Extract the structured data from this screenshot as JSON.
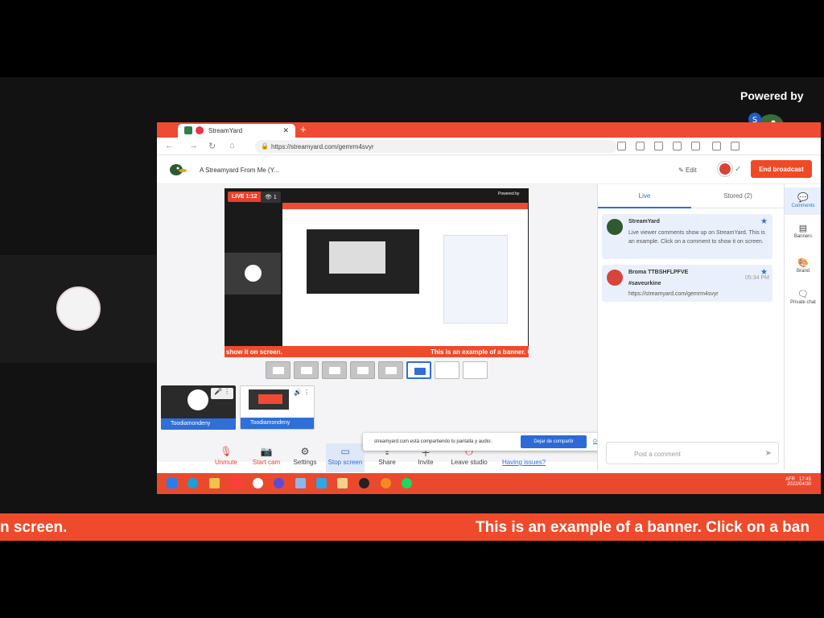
{
  "overlay": {
    "powered_by": "Powered by",
    "banner_left": "n screen.",
    "banner_right": "This is an example of a banner. Click on a ban"
  },
  "browser": {
    "tab_title": "StreamYard",
    "new_tab": "+",
    "url": "https://streamyard.com/gemrm4svyr"
  },
  "studio": {
    "broadcast_title": "A Streamyard From Me (Y...",
    "edit_label": "Edit",
    "end_broadcast_label": "End broadcast",
    "preview": {
      "live_badge": "LIVE 1:12",
      "viewer_count": "1",
      "powered": "Powered by",
      "banner_left": "show it on screen.",
      "banner_right": "This is an example of a banner. Clic"
    },
    "participants": [
      {
        "name": "Toodiamondeny"
      },
      {
        "name": "Toodiamondeny"
      }
    ],
    "toolbar": {
      "unmute": "Unmute",
      "start_cam": "Start cam",
      "settings": "Settings",
      "stop_screen": "Stop screen",
      "share": "Share",
      "invite": "Invite",
      "leave": "Leave studio",
      "issues": "Having issues?"
    },
    "share_notice": {
      "text": "streamyard.com está compartiendo tu pantalla y audio.",
      "stop_btn": "Dejar de compartir",
      "hide_btn": "Ocultar"
    }
  },
  "chat": {
    "tab_live": "Live",
    "tab_stored": "Stored (2)",
    "comments": [
      {
        "author": "StreamYard",
        "body": "Live viewer comments show up on StreamYard. This is an example. Click on a comment to show it on screen."
      },
      {
        "author": "Broma TTBSHFLPFVE",
        "body_line1": "#saveurkine",
        "body_line2": "https://streamyard.com/gemrm4svyr",
        "time": "05:34 PM"
      }
    ],
    "input_placeholder": "Post a comment"
  },
  "rail": {
    "comments": "Comments",
    "banners": "Banners",
    "brand": "Brand",
    "private_chat": "Private chat"
  },
  "taskbar": {
    "lang": "AFR",
    "time": "17:45",
    "date": "2022/04/30"
  },
  "colors": {
    "accent_red": "#ef4a2b",
    "accent_blue": "#2f6fd6"
  }
}
